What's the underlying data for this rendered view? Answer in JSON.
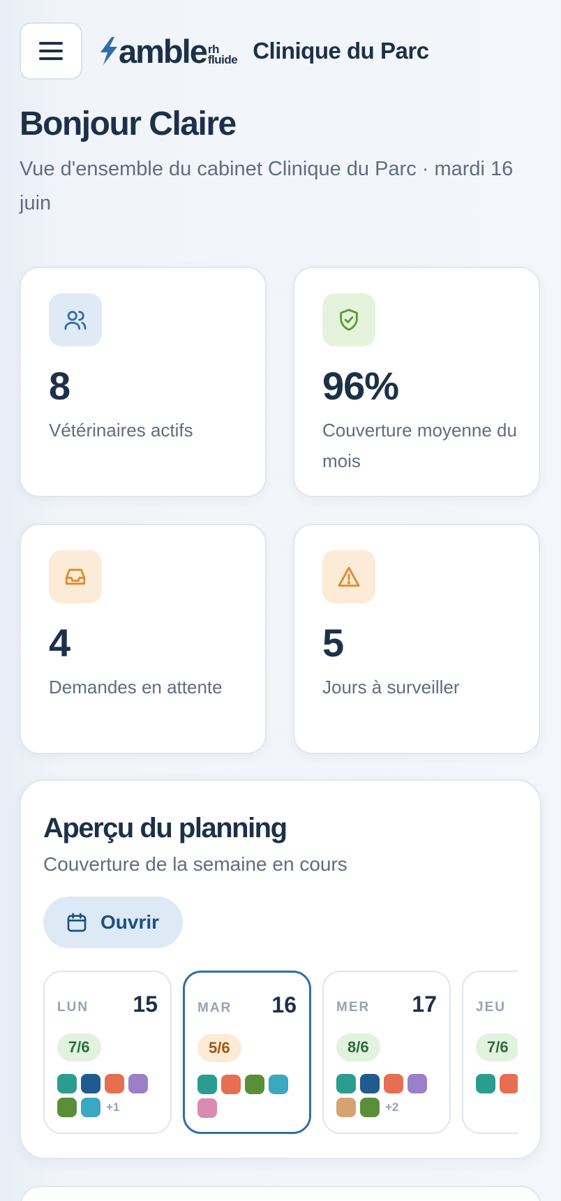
{
  "header": {
    "logo_word": "amble",
    "logo_sub_top": "rh",
    "logo_sub_bottom": "fluide",
    "clinic_name": "Clinique du Parc"
  },
  "greeting": "Bonjour Claire",
  "subtitle": "Vue d'ensemble du cabinet Clinique du Parc · mardi 16 juin",
  "stats": [
    {
      "value": "8",
      "label": "Vétérinaires actifs",
      "icon": "users-icon",
      "color": "#2f6ea8",
      "bg": "#e0eaf4"
    },
    {
      "value": "96%",
      "label": "Couverture moyenne du mois",
      "icon": "shield-check-icon",
      "color": "#5a9a2e",
      "bg": "#e5f3dc"
    },
    {
      "value": "4",
      "label": "Demandes en attente",
      "icon": "inbox-icon",
      "color": "#e08a2e",
      "bg": "#fcebd7"
    },
    {
      "value": "5",
      "label": "Jours à surveiller",
      "icon": "warning-icon",
      "color": "#e08a2e",
      "bg": "#fcebd7"
    }
  ],
  "planning": {
    "title": "Aperçu du planning",
    "subtitle": "Couverture de la semaine en cours",
    "open_label": "Ouvrir",
    "days": [
      {
        "name": "LUN",
        "date": "15",
        "coverage": "7/6",
        "status": "green",
        "active": false,
        "staff_colors": [
          "#2a9d8f",
          "#1f5b91",
          "#e76f51",
          "#9b7fc7",
          "#5a8f3a",
          "#3aa8c1"
        ],
        "more": "+1"
      },
      {
        "name": "MAR",
        "date": "16",
        "coverage": "5/6",
        "status": "amber",
        "active": true,
        "staff_colors": [
          "#2a9d8f",
          "#e76f51",
          "#5a8f3a",
          "#3aa8c1",
          "#d98bb0"
        ],
        "more": ""
      },
      {
        "name": "MER",
        "date": "17",
        "coverage": "8/6",
        "status": "green",
        "active": false,
        "staff_colors": [
          "#2a9d8f",
          "#1f5b91",
          "#e76f51",
          "#9b7fc7",
          "#d4a373",
          "#5a8f3a"
        ],
        "more": "+2"
      },
      {
        "name": "JEU",
        "date": "",
        "coverage": "7/6",
        "status": "green",
        "active": false,
        "staff_colors": [
          "#2a9d8f",
          "#e76f51",
          "#5a8f3a",
          "#3aa8c1"
        ],
        "more": ""
      }
    ]
  }
}
